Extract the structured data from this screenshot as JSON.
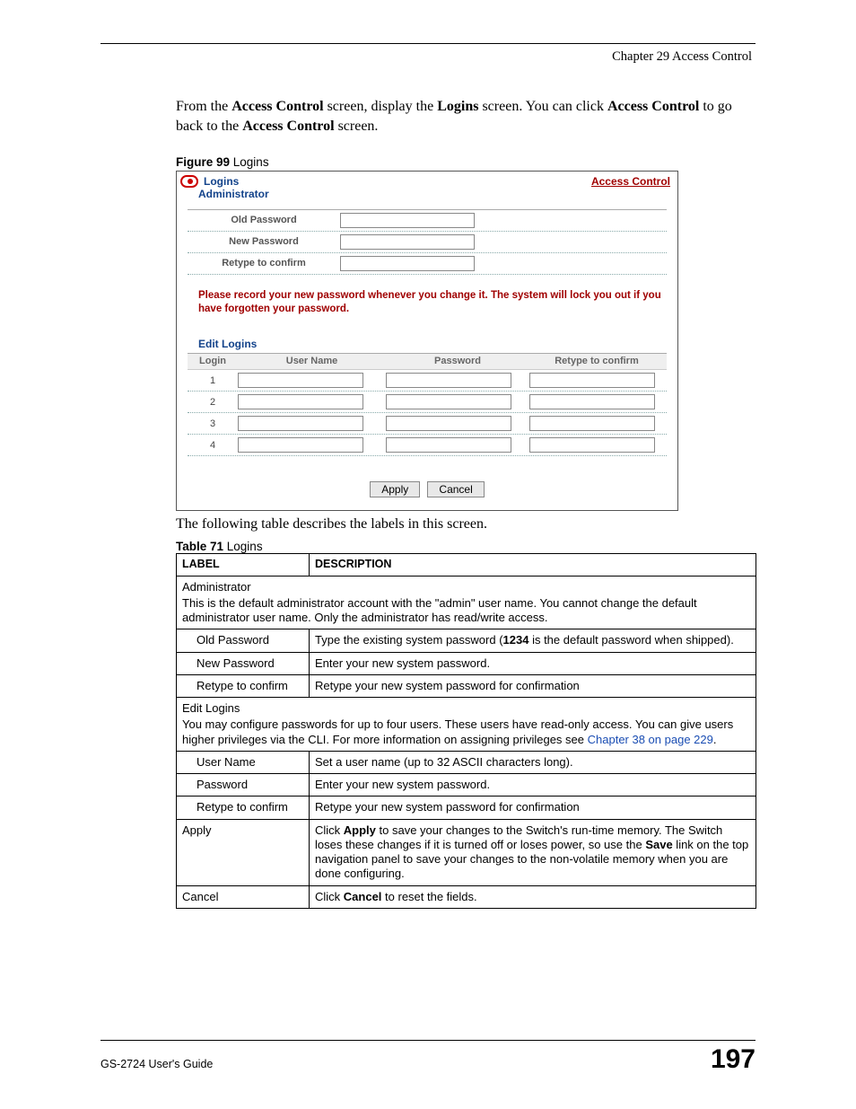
{
  "chapter_header": "Chapter 29 Access Control",
  "intro_html_parts": {
    "p1a": "From the ",
    "p1b": "Access Control",
    "p1c": " screen, display the ",
    "p1d": "Logins",
    "p1e": " screen. You can click ",
    "p1f": "Access Control",
    "p1g": " to go back to the ",
    "p1h": "Access Control",
    "p1i": " screen."
  },
  "figure_caption_num": "Figure 99",
  "figure_caption_text": "   Logins",
  "figure": {
    "title": "Logins",
    "top_link": "Access Control",
    "administrator": "Administrator",
    "rows": {
      "old_pw": "Old Password",
      "new_pw": "New Password",
      "retype": "Retype to confirm"
    },
    "warning": "Please record your new password whenever you change it. The system will lock you out if you have forgotten your password.",
    "edit_logins": "Edit Logins",
    "cols": {
      "login": "Login",
      "user": "User Name",
      "pw": "Password",
      "retype": "Retype to confirm"
    },
    "login_nums": [
      "1",
      "2",
      "3",
      "4"
    ],
    "btn_apply": "Apply",
    "btn_cancel": "Cancel"
  },
  "post_figure": "The following table describes the labels in this screen.",
  "table_caption_num": "Table 71",
  "table_caption_text": "   Logins",
  "table": {
    "head_label": "LABEL",
    "head_desc": "DESCRIPTION",
    "admin_section": "Administrator",
    "admin_desc": "This is the default administrator account with the \"admin\" user name. You cannot change the default administrator user name. Only the administrator has read/write access.",
    "rows1": [
      {
        "label": "Old Password",
        "desc_a": "Type the existing system password (",
        "desc_b": "1234",
        "desc_c": " is the default password when shipped)."
      },
      {
        "label": "New Password",
        "desc": "Enter your new system password."
      },
      {
        "label": "Retype to confirm",
        "desc": "Retype your new system password for confirmation"
      }
    ],
    "edit_section": "Edit Logins",
    "edit_desc_a": "You may configure passwords for up to four users. These users have read-only access. You can give users higher privileges via the CLI. For more information on assigning privileges see ",
    "edit_link": "Chapter 38 on page 229",
    "edit_desc_b": ".",
    "rows2": [
      {
        "label": "User Name",
        "desc": "Set a user name (up to 32 ASCII characters long)."
      },
      {
        "label": "Password",
        "desc": "Enter your new system password."
      },
      {
        "label": "Retype to confirm",
        "desc": "Retype your new system password for confirmation"
      }
    ],
    "apply_label": "Apply",
    "apply_desc_a": "Click ",
    "apply_b1": "Apply",
    "apply_desc_b": " to save your changes to the Switch's run-time memory. The Switch loses these changes if it is turned off or loses power, so use the ",
    "apply_b2": "Save",
    "apply_desc_c": " link on the top navigation panel to save your changes to the non-volatile memory when you are done configuring.",
    "cancel_label": "Cancel",
    "cancel_desc_a": "Click ",
    "cancel_b": "Cancel",
    "cancel_desc_b": " to reset the fields."
  },
  "footer_guide": "GS-2724 User's Guide",
  "footer_page": "197"
}
